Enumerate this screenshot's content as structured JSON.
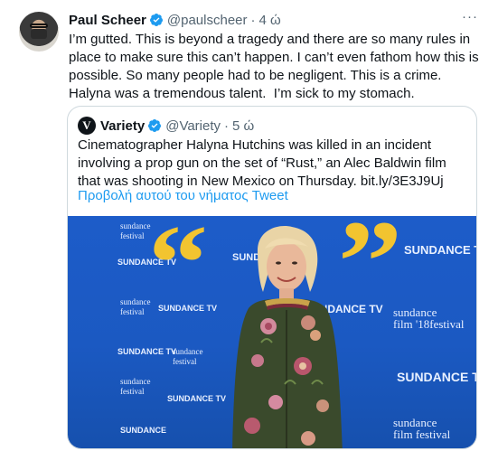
{
  "tweet": {
    "author_name": "Paul Scheer",
    "handle": "@paulscheer",
    "separator": "·",
    "time": "4 ώ",
    "more_label": "···",
    "text": "I’m gutted. This is beyond a tragedy and there are so many rules in place to make sure this can’t happen. I can’t even fathom how this is possible. So many people had to be negligent. This is a crime. Halyna was a tremendous talent.  I’m sick to my stomach."
  },
  "quoted_tweet": {
    "logo_letter": "V",
    "author_name": "Variety",
    "handle": "@Variety",
    "separator": "·",
    "time": "5 ώ",
    "text": "Cinematographer Halyna Hutchins was killed in an incident involving a prop gun on the set of “Rust,” an Alec Baldwin film that was shooting in New Mexico on Thursday. bit.ly/3E3J9Uj",
    "show_thread_link": "Προβολή αυτού του νήματος Tweet"
  },
  "photo_wall": {
    "brand": "SUNDANCE TV",
    "brand_short": "SUNDANCE",
    "fest_line1": "sundance",
    "fest_line2": "film",
    "fest_line3": "festival",
    "fest_year": "'18",
    "tv_suffix": "TV"
  },
  "colors": {
    "accent": "#1d9bf0",
    "secondary_text": "#536471",
    "backdrop_blue": "#1b59c2",
    "quote_mark_yellow": "#f2c430"
  }
}
